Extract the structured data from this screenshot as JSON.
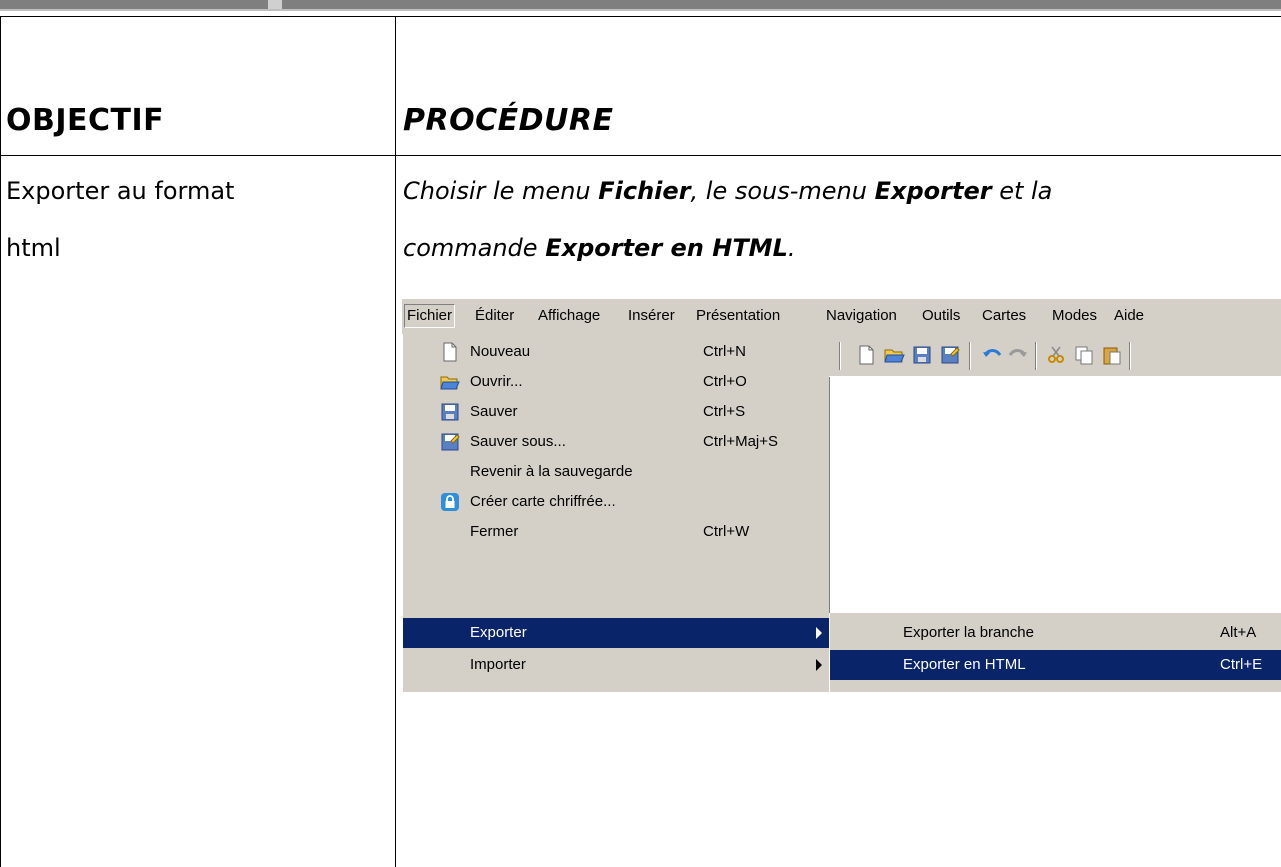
{
  "table": {
    "header_objectif": "OBJECTIF",
    "header_procedure": "PROCÉDURE",
    "objectif_line1": "Exporter au format",
    "objectif_line2": "html",
    "proc_l1_a": "Choisir le menu ",
    "proc_l1_b": "Fichier",
    "proc_l1_c": ", le sous-menu ",
    "proc_l1_d": "Exporter",
    "proc_l1_e": " et la",
    "proc_l2_a": "commande ",
    "proc_l2_b": "Exporter en HTML",
    "proc_l2_c": "."
  },
  "screenshot": {
    "menubar": [
      "Fichier",
      "Éditer",
      "Affichage",
      "Insérer",
      "Présentation",
      "Navigation",
      "Outils",
      "Cartes",
      "Modes",
      "Aide"
    ],
    "file_menu": [
      {
        "label": "Nouveau",
        "shortcut": "Ctrl+N",
        "icon": "new-document-icon"
      },
      {
        "label": "Ouvrir...",
        "shortcut": "Ctrl+O",
        "icon": "open-folder-icon"
      },
      {
        "label": "Sauver",
        "shortcut": "Ctrl+S",
        "icon": "save-disk-icon"
      },
      {
        "label": "Sauver sous...",
        "shortcut": "Ctrl+Maj+S",
        "icon": "save-as-icon"
      },
      {
        "label": "Revenir à la sauvegarde",
        "shortcut": "",
        "icon": ""
      },
      {
        "label": "Créer carte chriffrée...",
        "shortcut": "",
        "icon": "lock-icon"
      },
      {
        "label": "Fermer",
        "shortcut": "Ctrl+W",
        "icon": ""
      },
      {
        "label": "Exporter",
        "shortcut": "",
        "icon": "",
        "submenu": true,
        "selected": true
      },
      {
        "label": "Importer",
        "shortcut": "",
        "icon": "",
        "submenu": true
      }
    ],
    "export_submenu": [
      {
        "label": "Exporter la branche",
        "shortcut": "Alt+A"
      },
      {
        "label": "Exporter en HTML",
        "shortcut": "Ctrl+E",
        "selected": true
      }
    ],
    "colors": {
      "menu_bg": "#d4d0c8",
      "highlight": "#0a246a",
      "highlight_text": "#ffffff"
    }
  }
}
